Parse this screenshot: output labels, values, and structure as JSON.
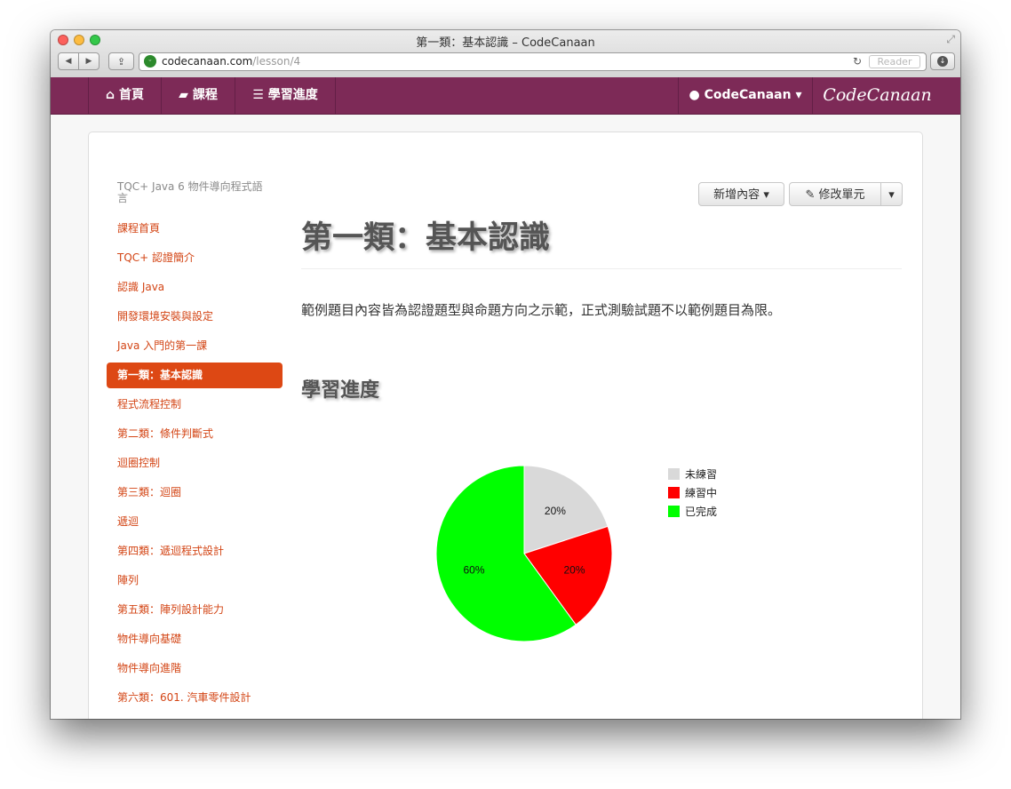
{
  "window": {
    "title": "第一類：基本認識 – CodeCanaan"
  },
  "browser": {
    "url_domain": "codecanaan.com",
    "url_path": "/lesson/4",
    "reader_label": "Reader"
  },
  "navbar": {
    "home": "首頁",
    "courses": "課程",
    "progress": "學習進度",
    "user": "CodeCanaan",
    "brand": "CodeCanaan"
  },
  "sidebar": {
    "heading": "TQC+ Java 6 物件導向程式語言",
    "items": [
      {
        "label": "課程首頁"
      },
      {
        "label": "TQC+ 認證簡介"
      },
      {
        "label": "認識 Java"
      },
      {
        "label": "開發環境安裝與設定"
      },
      {
        "label": "Java 入門的第一課"
      },
      {
        "label": "第一類：基本認識",
        "active": true
      },
      {
        "label": "程式流程控制"
      },
      {
        "label": "第二類：條件判斷式"
      },
      {
        "label": "迴圈控制"
      },
      {
        "label": "第三類：迴圈"
      },
      {
        "label": "遞迴"
      },
      {
        "label": "第四類：遞迴程式設計"
      },
      {
        "label": "陣列"
      },
      {
        "label": "第五類：陣列設計能力"
      },
      {
        "label": "物件導向基礎"
      },
      {
        "label": "物件導向進階"
      },
      {
        "label": "第六類：601. 汽車零件設計"
      }
    ]
  },
  "toolbar": {
    "add_content": "新增內容",
    "edit_unit": "修改單元"
  },
  "main": {
    "title": "第一類：基本認識",
    "description": "範例題目內容皆為認證題型與命題方向之示範，正式測驗試題不以範例題目為限。",
    "progress_heading": "學習進度"
  },
  "chart_data": {
    "type": "pie",
    "categories": [
      "未練習",
      "練習中",
      "已完成"
    ],
    "values": [
      20,
      20,
      60
    ],
    "labels": [
      "20%",
      "20%",
      "60%"
    ],
    "colors": [
      "#d9d9d9",
      "#ff0000",
      "#00ff00"
    ],
    "legend": "right"
  }
}
